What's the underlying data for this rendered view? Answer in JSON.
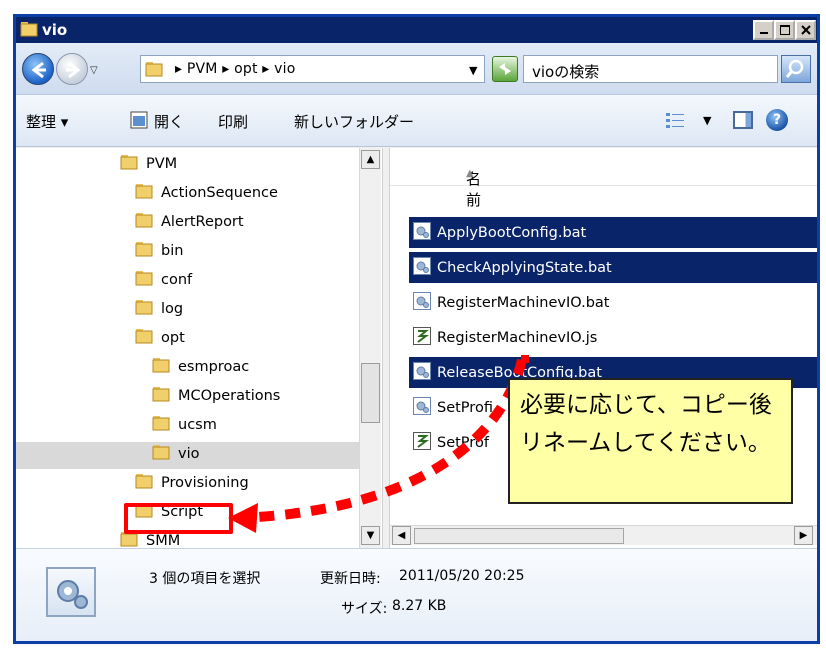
{
  "window": {
    "title": "vio"
  },
  "address": {
    "crumbs": [
      "PVM",
      "opt",
      "vio"
    ],
    "crumb_text": "▸ PVM ▸ opt ▸ vio",
    "search_placeholder": "vioの検索"
  },
  "toolbar": {
    "organize": "整理 ▾",
    "open": "開く",
    "print": "印刷",
    "new_folder": "新しいフォルダー"
  },
  "tree": {
    "items": [
      {
        "label": "PVM"
      },
      {
        "label": "ActionSequence"
      },
      {
        "label": "AlertReport"
      },
      {
        "label": "bin"
      },
      {
        "label": "conf"
      },
      {
        "label": "log"
      },
      {
        "label": "opt"
      },
      {
        "label": "esmproac"
      },
      {
        "label": "MCOperations"
      },
      {
        "label": "ucsm"
      },
      {
        "label": "vio"
      },
      {
        "label": "Provisioning"
      },
      {
        "label": "Script"
      },
      {
        "label": "SMM"
      }
    ]
  },
  "files": {
    "column_name": "名前",
    "items": [
      {
        "name": "ApplyBootConfig.bat",
        "type": "bat",
        "selected": true
      },
      {
        "name": "CheckApplyingState.bat",
        "type": "bat",
        "selected": true
      },
      {
        "name": "RegisterMachinevIO.bat",
        "type": "bat",
        "selected": false
      },
      {
        "name": "RegisterMachinevIO.js",
        "type": "js",
        "selected": false
      },
      {
        "name": "ReleaseBootConfig.bat",
        "type": "bat",
        "selected": true
      },
      {
        "name": "SetProfi",
        "type": "bat",
        "selected": false
      },
      {
        "name": "SetProf",
        "type": "js",
        "selected": false
      }
    ]
  },
  "details": {
    "selection": "3 個の項目を選択",
    "modified_label": "更新日時:",
    "modified_value": "2011/05/20 20:25",
    "size_label": "サイズ:",
    "size_value": "8.27 KB"
  },
  "callout": {
    "text": "必要に応じて、コピー後リネームしてください。"
  },
  "colors": {
    "titlebar": "#0a246a",
    "selection": "#0a246a",
    "callout": "#ffffa6",
    "annotation": "#ff0000"
  }
}
